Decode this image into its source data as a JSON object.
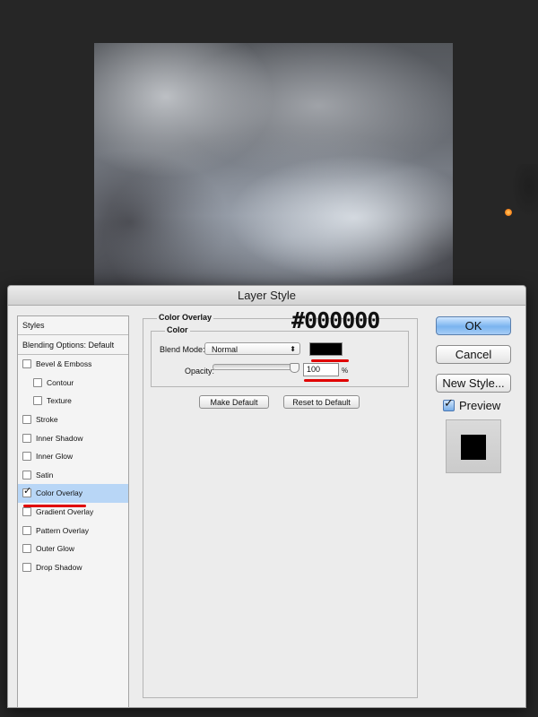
{
  "dialog": {
    "title": "Layer Style"
  },
  "styles_panel": {
    "header": "Styles",
    "blending_options": "Blending Options: Default",
    "items": [
      {
        "label": "Bevel & Emboss",
        "checked": false,
        "selected": false
      },
      {
        "label": "Contour",
        "checked": false,
        "selected": false
      },
      {
        "label": "Texture",
        "checked": false,
        "selected": false
      },
      {
        "label": "Stroke",
        "checked": false,
        "selected": false
      },
      {
        "label": "Inner Shadow",
        "checked": false,
        "selected": false
      },
      {
        "label": "Inner Glow",
        "checked": false,
        "selected": false
      },
      {
        "label": "Satin",
        "checked": false,
        "selected": false
      },
      {
        "label": "Color Overlay",
        "checked": true,
        "selected": true
      },
      {
        "label": "Gradient Overlay",
        "checked": false,
        "selected": false
      },
      {
        "label": "Pattern Overlay",
        "checked": false,
        "selected": false
      },
      {
        "label": "Outer Glow",
        "checked": false,
        "selected": false
      },
      {
        "label": "Drop Shadow",
        "checked": false,
        "selected": false
      }
    ]
  },
  "color_overlay": {
    "section_title": "Color Overlay",
    "group_title": "Color",
    "blend_mode_label": "Blend Mode:",
    "blend_mode_value": "Normal",
    "overlay_color": "#000000",
    "hex_annotation": "#000000",
    "opacity_label": "Opacity:",
    "opacity_value": "100",
    "opacity_unit": "%",
    "make_default": "Make Default",
    "reset_to_default": "Reset to Default"
  },
  "actions": {
    "ok": "OK",
    "cancel": "Cancel",
    "new_style": "New Style...",
    "preview_label": "Preview",
    "preview_checked": true
  },
  "colors": {
    "annotation": "#e00000",
    "selection": "#b8d6f6",
    "default_button": "#7ab4ef"
  }
}
